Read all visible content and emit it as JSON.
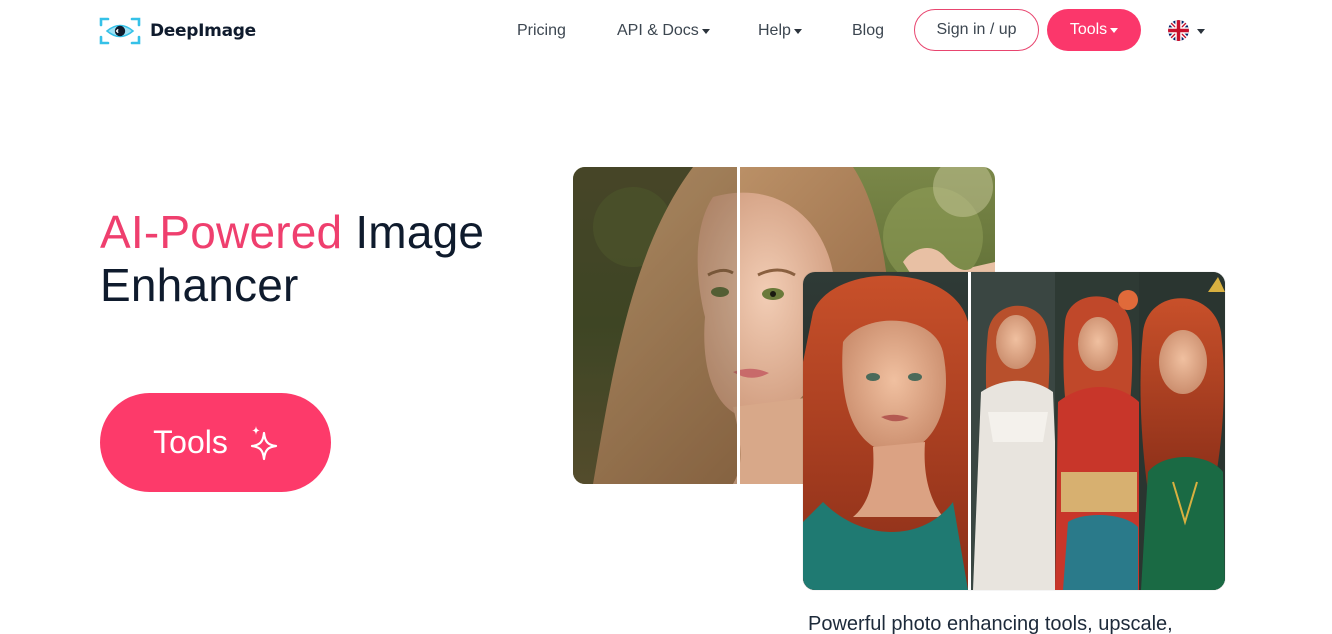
{
  "brand": {
    "name": "DeepImage",
    "logo_icon": "eye-in-frame-icon",
    "accent_color": "#fb376b"
  },
  "nav": {
    "pricing": "Pricing",
    "api_docs": "API & Docs",
    "help": "Help",
    "blog": "Blog",
    "signin": "Sign in / up",
    "tools": "Tools",
    "language_icon": "uk-flag-icon"
  },
  "hero": {
    "title_accent": "AI-Powered",
    "title_rest_1": "Image",
    "title_rest_2": "Enhancer",
    "cta_label": "Tools",
    "cta_icon": "sparkles-icon"
  },
  "images": {
    "back": "before-after-portrait-blonde",
    "front": "before-after-portraits-redhead"
  },
  "tagline": "Powerful photo enhancing tools, upscale,"
}
